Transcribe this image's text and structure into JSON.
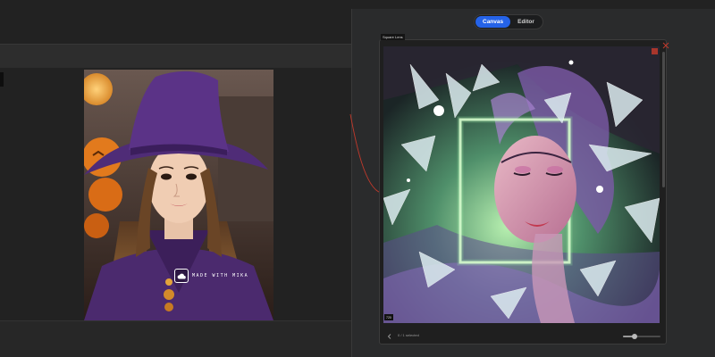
{
  "workspace": {
    "watermark_text": "MADE WITH MIKA",
    "watermark_icon": "cloud-icon"
  },
  "view_toggle": {
    "tabs": [
      {
        "label": "Canvas",
        "active": true
      },
      {
        "label": "Editor",
        "active": false
      }
    ]
  },
  "node": {
    "label": "Square Lens",
    "output_badge": "720",
    "footer_status": "0 / 1 selected",
    "zoom_fraction": 0.3,
    "close_icon": "close-icon",
    "arrow_icon": "chevron-left-icon"
  },
  "colors": {
    "accent": "#2563e8",
    "connector": "#c0392b",
    "panel_dark": "#1f1f1f",
    "workspace": "#222222"
  }
}
